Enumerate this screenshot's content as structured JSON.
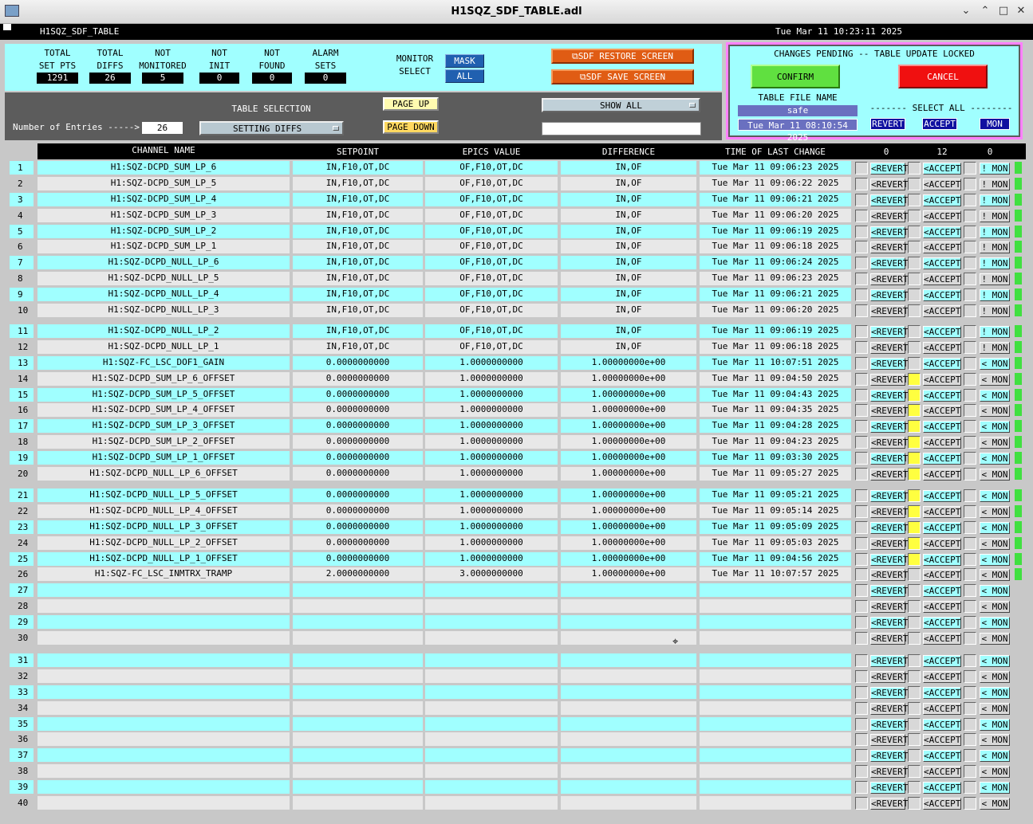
{
  "window": {
    "title": "H1SQZ_SDF_TABLE.adl",
    "minimize": "⌄",
    "restore": "⌃",
    "maximize": "□",
    "close": "✕"
  },
  "bar": {
    "screen_name": "H1SQZ_SDF_TABLE",
    "datetime": "Tue Mar 11 10:23:11 2025"
  },
  "stats": [
    {
      "label1": "TOTAL",
      "label2": "SET PTS",
      "value": "1291"
    },
    {
      "label1": "TOTAL",
      "label2": "DIFFS",
      "value": "26"
    },
    {
      "label1": "NOT",
      "label2": "MONITORED",
      "value": "5"
    },
    {
      "label1": "NOT",
      "label2": "INIT",
      "value": "0"
    },
    {
      "label1": "NOT",
      "label2": "FOUND",
      "value": "0"
    },
    {
      "label1": "ALARM",
      "label2": "SETS",
      "value": "0"
    }
  ],
  "monitor_select": {
    "label1": "MONITOR",
    "label2": "SELECT",
    "mask": "MASK",
    "all": "ALL"
  },
  "buttons": {
    "restore": "SDF RESTORE SCREEN",
    "save": "SDF SAVE SCREEN",
    "page_up": "PAGE UP",
    "page_down": "PAGE DOWN",
    "show_all": "SHOW ALL",
    "confirm": "CONFIRM",
    "cancel": "CANCEL"
  },
  "table_selection": {
    "label": "TABLE SELECTION",
    "value": "SETTING DIFFS",
    "entries_label": "Number of Entries ----->",
    "entries": "26",
    "filter": ""
  },
  "pending": {
    "title": "CHANGES PENDING -- TABLE UPDATE LOCKED",
    "file_label": "TABLE FILE NAME",
    "file_name": "safe",
    "file_time": "Tue Mar 11 08:10:54 2025",
    "select_all": "------- SELECT ALL --------",
    "revert": "REVERT",
    "accept": "ACCEPT",
    "mon": "MON"
  },
  "table": {
    "headers": {
      "channel": "CHANNEL NAME",
      "setpoint": "SETPOINT",
      "epics": "EPICS VALUE",
      "diff": "DIFFERENCE",
      "time": "TIME OF LAST CHANGE",
      "count_revert": "0",
      "count_accept": "12",
      "count_mon": "0"
    },
    "labels": {
      "revert": "<REVERT",
      "accept": "<ACCEPT",
      "mon_excl": "! MON",
      "mon_lt": "< MON"
    },
    "rows": [
      {
        "n": "1",
        "ch": "H1:SQZ-DCPD_SUM_LP_6",
        "sp": "IN,F10,OT,DC",
        "ev": "OF,F10,OT,DC",
        "df": "IN,OF",
        "tm": "Tue Mar 11 09:06:23 2025"
      },
      {
        "n": "2",
        "ch": "H1:SQZ-DCPD_SUM_LP_5",
        "sp": "IN,F10,OT,DC",
        "ev": "OF,F10,OT,DC",
        "df": "IN,OF",
        "tm": "Tue Mar 11 09:06:22 2025"
      },
      {
        "n": "3",
        "ch": "H1:SQZ-DCPD_SUM_LP_4",
        "sp": "IN,F10,OT,DC",
        "ev": "OF,F10,OT,DC",
        "df": "IN,OF",
        "tm": "Tue Mar 11 09:06:21 2025"
      },
      {
        "n": "4",
        "ch": "H1:SQZ-DCPD_SUM_LP_3",
        "sp": "IN,F10,OT,DC",
        "ev": "OF,F10,OT,DC",
        "df": "IN,OF",
        "tm": "Tue Mar 11 09:06:20 2025"
      },
      {
        "n": "5",
        "ch": "H1:SQZ-DCPD_SUM_LP_2",
        "sp": "IN,F10,OT,DC",
        "ev": "OF,F10,OT,DC",
        "df": "IN,OF",
        "tm": "Tue Mar 11 09:06:19 2025"
      },
      {
        "n": "6",
        "ch": "H1:SQZ-DCPD_SUM_LP_1",
        "sp": "IN,F10,OT,DC",
        "ev": "OF,F10,OT,DC",
        "df": "IN,OF",
        "tm": "Tue Mar 11 09:06:18 2025"
      },
      {
        "n": "7",
        "ch": "H1:SQZ-DCPD_NULL_LP_6",
        "sp": "IN,F10,OT,DC",
        "ev": "OF,F10,OT,DC",
        "df": "IN,OF",
        "tm": "Tue Mar 11 09:06:24 2025"
      },
      {
        "n": "8",
        "ch": "H1:SQZ-DCPD_NULL_LP_5",
        "sp": "IN,F10,OT,DC",
        "ev": "OF,F10,OT,DC",
        "df": "IN,OF",
        "tm": "Tue Mar 11 09:06:23 2025"
      },
      {
        "n": "9",
        "ch": "H1:SQZ-DCPD_NULL_LP_4",
        "sp": "IN,F10,OT,DC",
        "ev": "OF,F10,OT,DC",
        "df": "IN,OF",
        "tm": "Tue Mar 11 09:06:21 2025"
      },
      {
        "n": "10",
        "ch": "H1:SQZ-DCPD_NULL_LP_3",
        "sp": "IN,F10,OT,DC",
        "ev": "OF,F10,OT,DC",
        "df": "IN,OF",
        "tm": "Tue Mar 11 09:06:20 2025"
      },
      {
        "n": "11",
        "ch": "H1:SQZ-DCPD_NULL_LP_2",
        "sp": "IN,F10,OT,DC",
        "ev": "OF,F10,OT,DC",
        "df": "IN,OF",
        "tm": "Tue Mar 11 09:06:19 2025"
      },
      {
        "n": "12",
        "ch": "H1:SQZ-DCPD_NULL_LP_1",
        "sp": "IN,F10,OT,DC",
        "ev": "OF,F10,OT,DC",
        "df": "IN,OF",
        "tm": "Tue Mar 11 09:06:18 2025"
      },
      {
        "n": "13",
        "ch": "H1:SQZ-FC_LSC_DOF1_GAIN",
        "sp": "0.0000000000",
        "ev": "1.0000000000",
        "df": "1.00000000e+00",
        "tm": "Tue Mar 11 10:07:51 2025"
      },
      {
        "n": "14",
        "ch": "H1:SQZ-DCPD_SUM_LP_6_OFFSET",
        "sp": "0.0000000000",
        "ev": "1.0000000000",
        "df": "1.00000000e+00",
        "tm": "Tue Mar 11 09:04:50 2025"
      },
      {
        "n": "15",
        "ch": "H1:SQZ-DCPD_SUM_LP_5_OFFSET",
        "sp": "0.0000000000",
        "ev": "1.0000000000",
        "df": "1.00000000e+00",
        "tm": "Tue Mar 11 09:04:43 2025"
      },
      {
        "n": "16",
        "ch": "H1:SQZ-DCPD_SUM_LP_4_OFFSET",
        "sp": "0.0000000000",
        "ev": "1.0000000000",
        "df": "1.00000000e+00",
        "tm": "Tue Mar 11 09:04:35 2025"
      },
      {
        "n": "17",
        "ch": "H1:SQZ-DCPD_SUM_LP_3_OFFSET",
        "sp": "0.0000000000",
        "ev": "1.0000000000",
        "df": "1.00000000e+00",
        "tm": "Tue Mar 11 09:04:28 2025"
      },
      {
        "n": "18",
        "ch": "H1:SQZ-DCPD_SUM_LP_2_OFFSET",
        "sp": "0.0000000000",
        "ev": "1.0000000000",
        "df": "1.00000000e+00",
        "tm": "Tue Mar 11 09:04:23 2025"
      },
      {
        "n": "19",
        "ch": "H1:SQZ-DCPD_SUM_LP_1_OFFSET",
        "sp": "0.0000000000",
        "ev": "1.0000000000",
        "df": "1.00000000e+00",
        "tm": "Tue Mar 11 09:03:30 2025"
      },
      {
        "n": "20",
        "ch": "H1:SQZ-DCPD_NULL_LP_6_OFFSET",
        "sp": "0.0000000000",
        "ev": "1.0000000000",
        "df": "1.00000000e+00",
        "tm": "Tue Mar 11 09:05:27 2025"
      },
      {
        "n": "21",
        "ch": "H1:SQZ-DCPD_NULL_LP_5_OFFSET",
        "sp": "0.0000000000",
        "ev": "1.0000000000",
        "df": "1.00000000e+00",
        "tm": "Tue Mar 11 09:05:21 2025"
      },
      {
        "n": "22",
        "ch": "H1:SQZ-DCPD_NULL_LP_4_OFFSET",
        "sp": "0.0000000000",
        "ev": "1.0000000000",
        "df": "1.00000000e+00",
        "tm": "Tue Mar 11 09:05:14 2025"
      },
      {
        "n": "23",
        "ch": "H1:SQZ-DCPD_NULL_LP_3_OFFSET",
        "sp": "0.0000000000",
        "ev": "1.0000000000",
        "df": "1.00000000e+00",
        "tm": "Tue Mar 11 09:05:09 2025"
      },
      {
        "n": "24",
        "ch": "H1:SQZ-DCPD_NULL_LP_2_OFFSET",
        "sp": "0.0000000000",
        "ev": "1.0000000000",
        "df": "1.00000000e+00",
        "tm": "Tue Mar 11 09:05:03 2025"
      },
      {
        "n": "25",
        "ch": "H1:SQZ-DCPD_NULL_LP_1_OFFSET",
        "sp": "0.0000000000",
        "ev": "1.0000000000",
        "df": "1.00000000e+00",
        "tm": "Tue Mar 11 09:04:56 2025"
      },
      {
        "n": "26",
        "ch": "H1:SQZ-FC_LSC_INMTRX_TRAMP",
        "sp": "2.0000000000",
        "ev": "3.0000000000",
        "df": "1.00000000e+00",
        "tm": "Tue Mar 11 10:07:57 2025"
      },
      {
        "n": "27",
        "ch": "",
        "sp": "",
        "ev": "",
        "df": "",
        "tm": ""
      },
      {
        "n": "28",
        "ch": "",
        "sp": "",
        "ev": "",
        "df": "",
        "tm": ""
      },
      {
        "n": "29",
        "ch": "",
        "sp": "",
        "ev": "",
        "df": "",
        "tm": ""
      },
      {
        "n": "30",
        "ch": "",
        "sp": "",
        "ev": "",
        "df": "",
        "tm": ""
      },
      {
        "n": "31",
        "ch": "",
        "sp": "",
        "ev": "",
        "df": "",
        "tm": ""
      },
      {
        "n": "32",
        "ch": "",
        "sp": "",
        "ev": "",
        "df": "",
        "tm": ""
      },
      {
        "n": "33",
        "ch": "",
        "sp": "",
        "ev": "",
        "df": "",
        "tm": ""
      },
      {
        "n": "34",
        "ch": "",
        "sp": "",
        "ev": "",
        "df": "",
        "tm": ""
      },
      {
        "n": "35",
        "ch": "",
        "sp": "",
        "ev": "",
        "df": "",
        "tm": ""
      },
      {
        "n": "36",
        "ch": "",
        "sp": "",
        "ev": "",
        "df": "",
        "tm": ""
      },
      {
        "n": "37",
        "ch": "",
        "sp": "",
        "ev": "",
        "df": "",
        "tm": ""
      },
      {
        "n": "38",
        "ch": "",
        "sp": "",
        "ev": "",
        "df": "",
        "tm": ""
      },
      {
        "n": "39",
        "ch": "",
        "sp": "",
        "ev": "",
        "df": "",
        "tm": ""
      },
      {
        "n": "40",
        "ch": "",
        "sp": "",
        "ev": "",
        "df": "",
        "tm": ""
      }
    ]
  },
  "colors": {
    "cyan": "#a0ffff",
    "gray": "#c8c8c8",
    "accept_marked": "#ffff40",
    "monitor_green": "#40e040"
  }
}
